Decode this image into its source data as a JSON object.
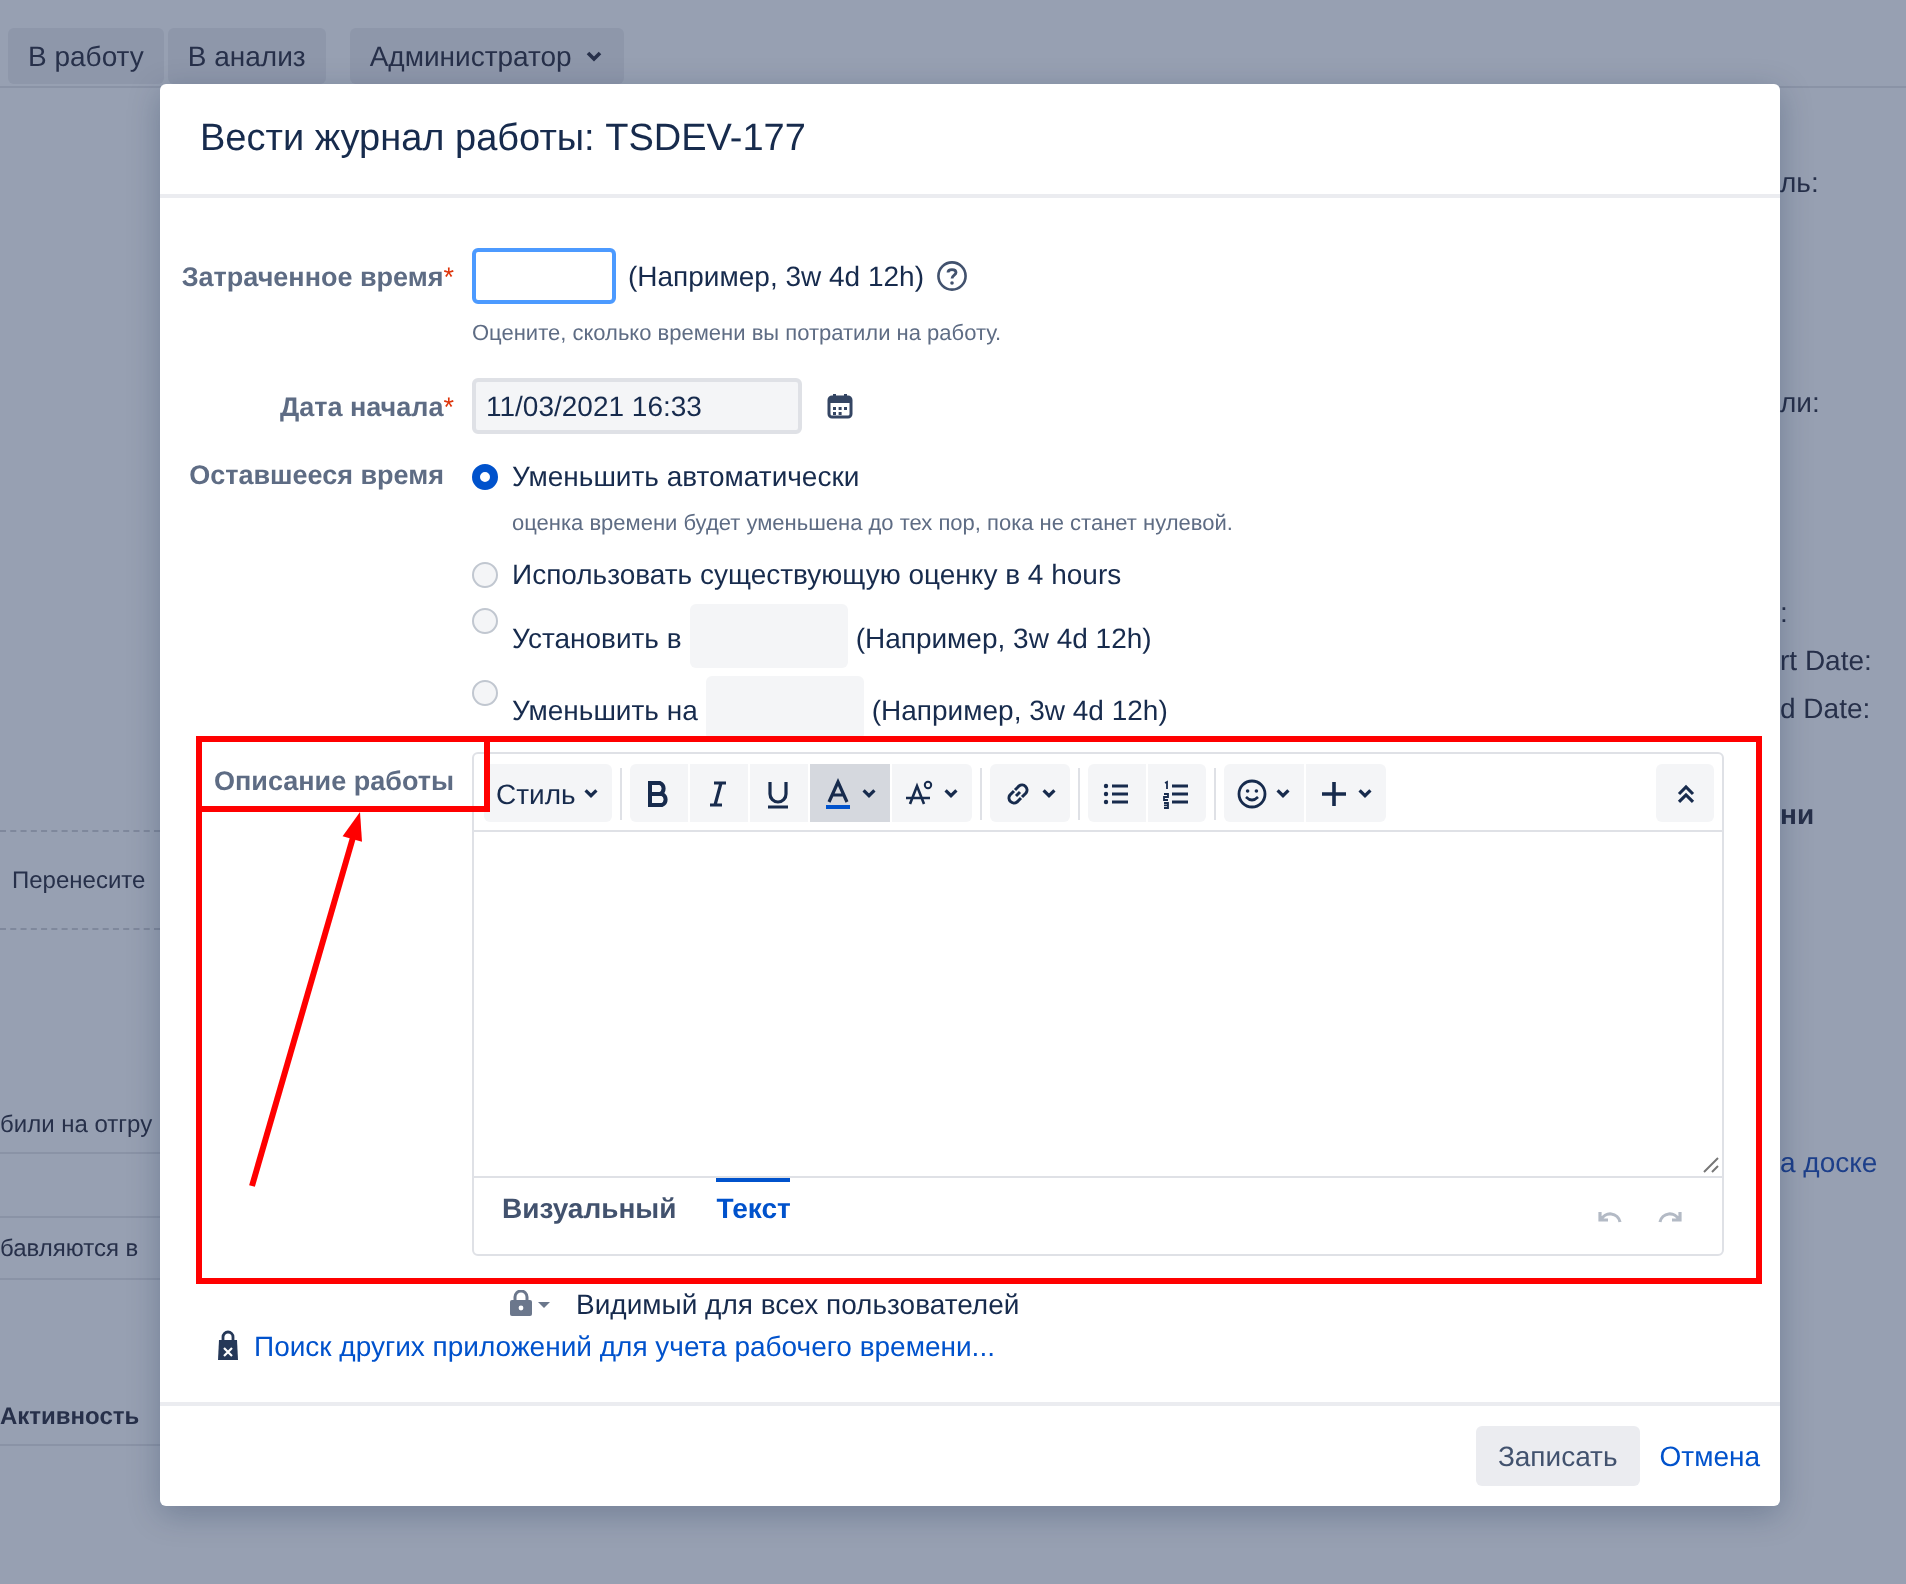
{
  "background": {
    "actions": [
      {
        "label": "В работу",
        "kind": "plain"
      },
      {
        "label": "В анализ",
        "kind": "plain"
      },
      {
        "label": "Администратор",
        "kind": "dropdown"
      }
    ],
    "left_texts": [
      {
        "text": "Перенесите",
        "kind": "text"
      },
      {
        "text": "били на отгру",
        "kind": "text"
      },
      {
        "text": "бавляются в",
        "kind": "text"
      },
      {
        "text": "Активность",
        "kind": "heading"
      }
    ],
    "right_texts": [
      {
        "text": "ль:",
        "kind": "text"
      },
      {
        "text": "ли:",
        "kind": "text"
      },
      {
        "text": ":",
        "kind": "text"
      },
      {
        "text": "rt Date:",
        "kind": "text"
      },
      {
        "text": "d Date:",
        "kind": "text"
      },
      {
        "text": "ни",
        "kind": "heading"
      },
      {
        "text": "а доске",
        "kind": "link"
      }
    ]
  },
  "dialog": {
    "title": "Вести журнал работы: TSDEV-177",
    "time_spent": {
      "label": "Затраченное время",
      "required_mark": "*",
      "focused": true,
      "hint": "(Например, 3w 4d 12h)",
      "description": "Оцените, сколько времени вы потратили на работу."
    },
    "start_date": {
      "label": "Дата начала",
      "required_mark": "*",
      "value": "11/03/2021 16:33"
    },
    "remaining": {
      "label": "Оставшееся время",
      "options": [
        {
          "kind": "plain",
          "label": "Уменьшить автоматически",
          "selected": true,
          "note": "оценка времени будет уменьшена до тех пор, пока не станет нулевой."
        },
        {
          "kind": "plain",
          "label": "Использовать существующую оценку в 4 hours",
          "selected": false
        },
        {
          "kind": "field",
          "label": "Установить в",
          "hint": "(Например, 3w 4d 12h)",
          "selected": false
        },
        {
          "kind": "field",
          "label": "Уменьшить на",
          "hint": "(Например, 3w 4d 12h)",
          "selected": false
        }
      ]
    },
    "description": {
      "label": "Описание работы",
      "style_label": "Стиль",
      "tool_groups": [
        [
          {
            "kind": "bold",
            "active": false
          },
          {
            "kind": "italic",
            "active": false
          },
          {
            "kind": "underline",
            "active": false
          },
          {
            "kind": "text-color",
            "active": true
          },
          {
            "kind": "format",
            "active": false
          }
        ],
        [
          {
            "kind": "link",
            "active": false
          }
        ],
        [
          {
            "kind": "bullets",
            "active": false
          },
          {
            "kind": "numbers",
            "active": false
          }
        ],
        [
          {
            "kind": "emoji",
            "active": false
          },
          {
            "kind": "insert",
            "active": false
          }
        ]
      ],
      "tabs": [
        {
          "label": "Визуальный",
          "selected": false
        },
        {
          "label": "Текст",
          "selected": true
        }
      ]
    },
    "visibility": "Видимый для всех пользователей",
    "apps_link": "Поиск других приложений для учета рабочего времени...",
    "buttons": [
      {
        "label": "Записать",
        "kind": "primary"
      },
      {
        "label": "Отмена",
        "kind": "link"
      }
    ]
  }
}
